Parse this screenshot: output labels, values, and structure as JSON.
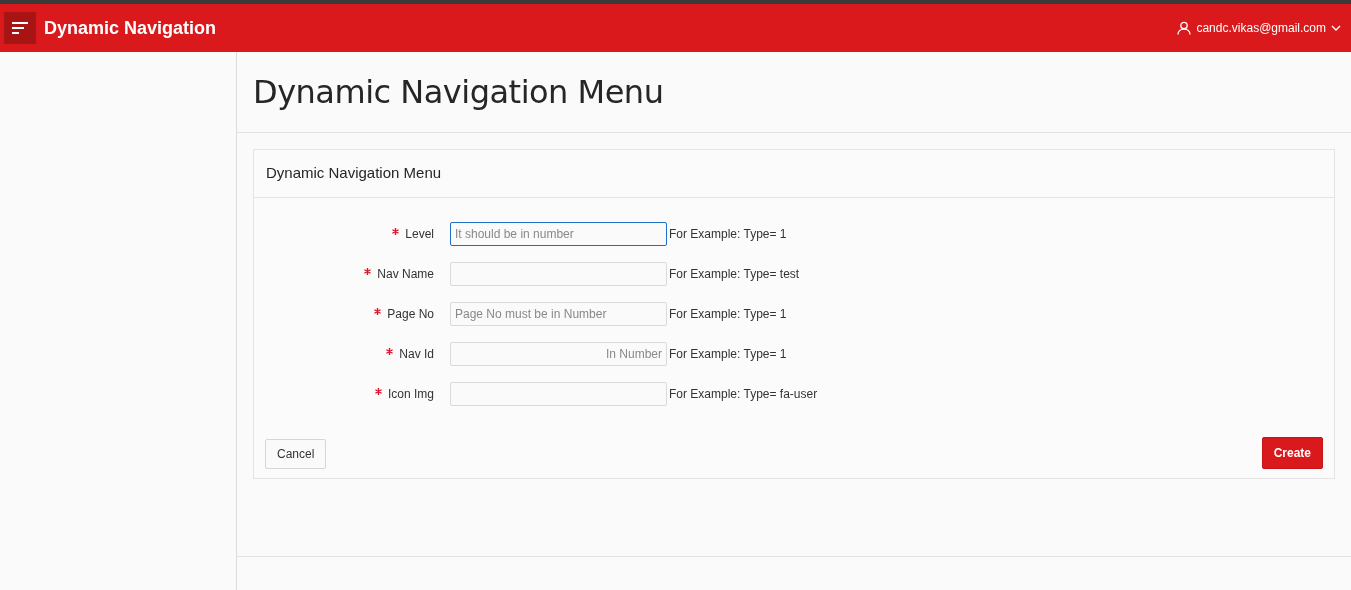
{
  "header": {
    "title": "Dynamic Navigation",
    "user": "candc.vikas@gmail.com"
  },
  "page_title": "Dynamic Navigation Menu",
  "region": {
    "title": "Dynamic Navigation Menu",
    "fields": [
      {
        "label": "Level",
        "required": true,
        "placeholder": "It should be in number",
        "align_right": false,
        "focused": true,
        "hint": "For Example: Type= 1"
      },
      {
        "label": "Nav Name",
        "required": true,
        "focused": false,
        "hint": "For Example: Type= test"
      },
      {
        "label": "Page No",
        "required": true,
        "placeholder": "Page No must be in Number",
        "align_right": false,
        "focused": false,
        "hint": "For Example: Type= 1"
      },
      {
        "label": "Nav Id",
        "required": true,
        "placeholder": "In Number",
        "align_right": true,
        "focused": false,
        "hint": "For Example: Type= 1"
      },
      {
        "label": "Icon Img",
        "required": true,
        "focused": false,
        "hint": "For Example: Type= fa-user"
      }
    ],
    "buttons": [
      {
        "label": "Cancel",
        "kind": "secondary"
      },
      {
        "label": "Create",
        "kind": "primary"
      }
    ]
  }
}
